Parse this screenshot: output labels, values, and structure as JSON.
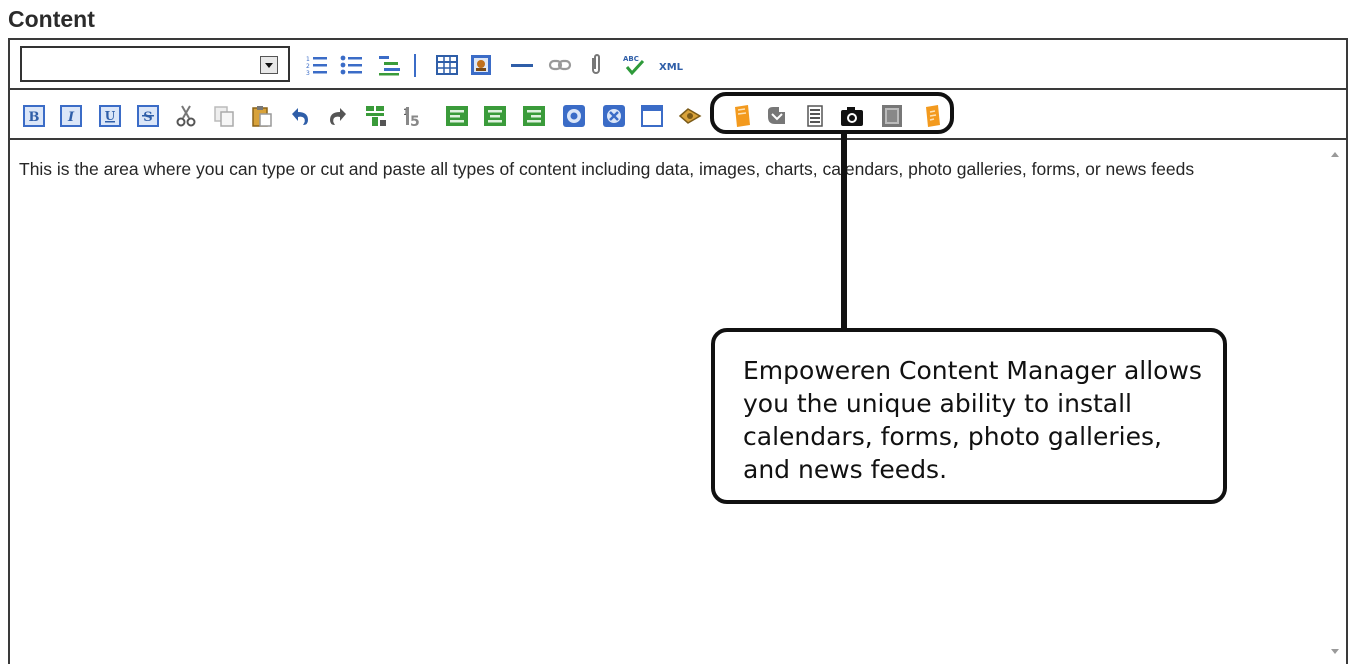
{
  "section": {
    "label": "Content"
  },
  "toolbar_row1": {
    "format_select_value": "",
    "icons": [
      "ordered-list-icon",
      "unordered-list-icon",
      "indent-list-icon",
      "separator-icon",
      "insert-table-icon",
      "insert-image-icon",
      "horizontal-rule-icon",
      "link-icon",
      "attachment-icon",
      "spellcheck-icon",
      "xml-icon"
    ]
  },
  "toolbar_row2": {
    "icons": [
      "bold-icon",
      "italic-icon",
      "underline-icon",
      "strikethrough-icon",
      "cut-icon",
      "copy-icon",
      "paste-icon",
      "undo-icon",
      "redo-icon",
      "find-icon",
      "replace-icon",
      "align-left-icon",
      "align-center-icon",
      "align-right-icon",
      "insert-object-icon",
      "insert-media-icon",
      "window-icon",
      "hyperlink-icon",
      "calendar-icon",
      "forms-icon",
      "document-icon",
      "photo-gallery-icon",
      "news-feed-icon",
      "rss-icon"
    ]
  },
  "editor": {
    "content_text": "This is the area where you can type or cut and paste all types of content including data, images, charts, calendars, photo galleries, forms, or news feeds"
  },
  "callout": {
    "text": "Empoweren Content Manager allows you the unique ability to install calendars, forms, photo galleries, and news feeds."
  },
  "colors": {
    "border": "#3a3a3a",
    "toolbar_blue": "#3b6cc7",
    "feature_orange": "#f39a1e",
    "text": "#262626"
  }
}
